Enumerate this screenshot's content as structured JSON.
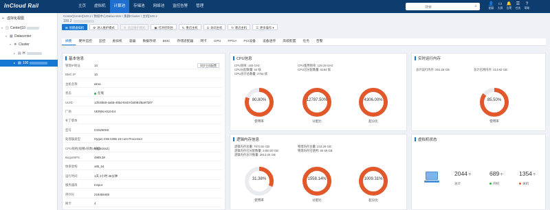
{
  "header": {
    "logo": "InCloud Rail",
    "nav": [
      {
        "label": "主页",
        "active": false
      },
      {
        "label": "虚拟机",
        "active": false
      },
      {
        "label": "计算池",
        "active": true
      },
      {
        "label": "存储池",
        "active": false
      },
      {
        "label": "网络池",
        "active": false
      },
      {
        "label": "监控告警",
        "active": false
      },
      {
        "label": "管理",
        "active": false
      }
    ],
    "search_placeholder": "搜索",
    "icons": [
      {
        "icon": "user-icon",
        "label": "超级"
      },
      {
        "icon": "help-icon",
        "label": "大屏"
      },
      {
        "icon": "bell-icon",
        "label": "告警"
      },
      {
        "icon": "task-icon",
        "label": "任务"
      },
      {
        "icon": "info-icon",
        "label": "帮助"
      }
    ]
  },
  "sidebar": {
    "items": [
      {
        "label": "虚拟化视图",
        "depth": 0,
        "icon": "collapse-icon"
      },
      {
        "label": "Center[10",
        "depth": 0,
        "icon": "center-icon"
      },
      {
        "label": "Datacenter",
        "depth": 1,
        "icon": "datacenter-icon"
      },
      {
        "label": "Cluster",
        "depth": 2,
        "icon": "cluster-icon"
      },
      {
        "label": "H",
        "depth": 3,
        "icon": "host-icon"
      },
      {
        "label": "100",
        "depth": 3,
        "icon": "host-icon",
        "selected": true
      }
    ]
  },
  "main": {
    "breadcrumb": "Center[Center[100.2 / 数据中心Datacenter / 集群Cluster / 主机[100.2",
    "hostname": "100.2",
    "actions": [
      {
        "label": "创建虚拟机",
        "icon": "add-icon",
        "primary": true
      },
      {
        "label": "进入维护模式",
        "icon": "wrench-icon"
      },
      {
        "label": "退出维护模式",
        "icon": "wrench-icon",
        "disabled": true
      },
      {
        "label": "打开控制台",
        "icon": "console-icon"
      },
      {
        "label": "重启主机",
        "icon": "restart-icon"
      },
      {
        "label": "关闭主机",
        "icon": "power-icon"
      },
      {
        "label": "重启主机",
        "icon": "restart-icon"
      },
      {
        "label": "更多操作",
        "icon": "more-icon"
      }
    ],
    "tabs": [
      "摘要",
      "硬件监控",
      "监控",
      "虚拟机",
      "容器",
      "数据存储",
      "BMC",
      "存储适配器",
      "网卡",
      "GPU",
      "FPGA",
      "PCI设备",
      "设备透传",
      "高级配置",
      "任务",
      "告警"
    ],
    "active_tab": "摘要"
  },
  "basic_info": {
    "title": "基本信息",
    "sync_button": "同步主机配置",
    "rows": [
      {
        "key": "管理IP地址",
        "value": "10"
      },
      {
        "key": "BMC IP",
        "value": "10"
      },
      {
        "key": "主机名称",
        "value": "alma"
      },
      {
        "key": "状态",
        "value": "在线",
        "status_color": "#2fb34a"
      },
      {
        "key": "UUID",
        "value": "12fc8b59-4a65-405d-9403-fa0081f6a97b07"
      },
      {
        "key": "厂商",
        "value": "VER9KA010-E4"
      },
      {
        "key": "补丁版本",
        "value": ""
      },
      {
        "key": "型号",
        "value": "CS5260H2"
      },
      {
        "key": "处理器类型",
        "value": "Hygon C86 5385 16-core Processor"
      },
      {
        "key": "CPU规格(插槽x核数x线程)",
        "value": "64(2x16x2)"
      },
      {
        "key": "BogoMIPS",
        "value": "4999.38"
      },
      {
        "key": "体系架构",
        "value": "x86_64"
      },
      {
        "key": "运行时间",
        "value": "1天 2小时 35分钟"
      },
      {
        "key": "服务器商",
        "value": "Inspur"
      },
      {
        "key": "序列号",
        "value": "218456469"
      },
      {
        "key": "网卡",
        "value": "4"
      }
    ]
  },
  "cpu": {
    "title": "CPU信息",
    "lines": [
      "CPU频率: 160 GHz",
      "CPU分配数量: 64 核",
      "CPU总计总数量: 2754 核",
      "CPU使用频率: 129.28 GHz",
      "CPU已分配数量: 8164 核"
    ],
    "gauges": [
      {
        "value": "80.80%",
        "label": "使用率",
        "fraction": 0.808
      },
      {
        "value": "12787.50%",
        "label": "分配比",
        "fraction": 1.0
      },
      {
        "value": "4306.00%",
        "label": "超分比",
        "fraction": 1.0
      }
    ]
  },
  "memory": {
    "title": "逻辑内存信息",
    "lines": [
      "逻辑内存总量: 7673.84 GB",
      "逻辑内存已分配数量: 2400.00 GB",
      "逻辑内存总计数量: 2813.00 GB",
      "物理内存总量: 243.29 GB",
      "物理内存已使用: 80.59 GB"
    ],
    "gauges": [
      {
        "value": "31.38%",
        "label": "使用率",
        "fraction": 0.3138
      },
      {
        "value": "1558.14%",
        "label": "分配比",
        "fraction": 1.0
      },
      {
        "value": "1009.31%",
        "label": "超分比",
        "fraction": 1.0
      }
    ]
  },
  "runtime_memory": {
    "title": "实时运行内存",
    "lines": [
      "总计运行内存: 251.26 GB",
      "总计已用内存: 214.82 GB"
    ],
    "gauge": {
      "value": "85.50%",
      "label": "使用率",
      "fraction": 0.855
    }
  },
  "vm_status": {
    "title": "虚拟机状态",
    "total": {
      "value": "2044",
      "unit": "个",
      "label": "总计"
    },
    "running": {
      "value": "689",
      "unit": "个",
      "label": "开机",
      "color": "#2fb34a"
    },
    "stopped": {
      "value": "1354",
      "unit": "个",
      "label": "关机",
      "color": "#e05a2b"
    }
  },
  "colors": {
    "accent": "#1677d3",
    "gauge_fill": "#e2582a",
    "gauge_track": "#e9ebee",
    "online": "#2fb34a"
  }
}
